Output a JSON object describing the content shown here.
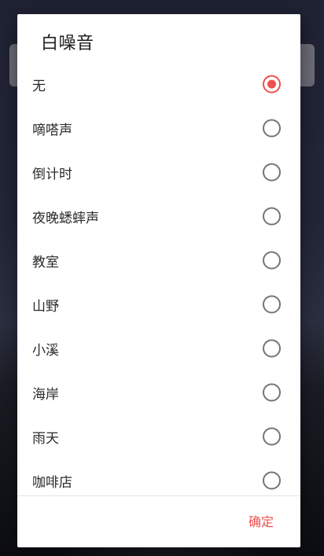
{
  "dialog": {
    "title": "白噪音",
    "selected_index": 0,
    "options": [
      {
        "label": "无",
        "checked": true
      },
      {
        "label": "嘀嗒声",
        "checked": false
      },
      {
        "label": "倒计时",
        "checked": false
      },
      {
        "label": "夜晚蟋蟀声",
        "checked": false
      },
      {
        "label": "教室",
        "checked": false
      },
      {
        "label": "山野",
        "checked": false
      },
      {
        "label": "小溪",
        "checked": false
      },
      {
        "label": "海岸",
        "checked": false
      },
      {
        "label": "雨天",
        "checked": false
      },
      {
        "label": "咖啡店",
        "checked": false
      }
    ],
    "confirm_label": "确定"
  },
  "colors": {
    "accent": "#f0504e",
    "radio_unchecked": "#757575",
    "text": "#2a2a2a"
  }
}
